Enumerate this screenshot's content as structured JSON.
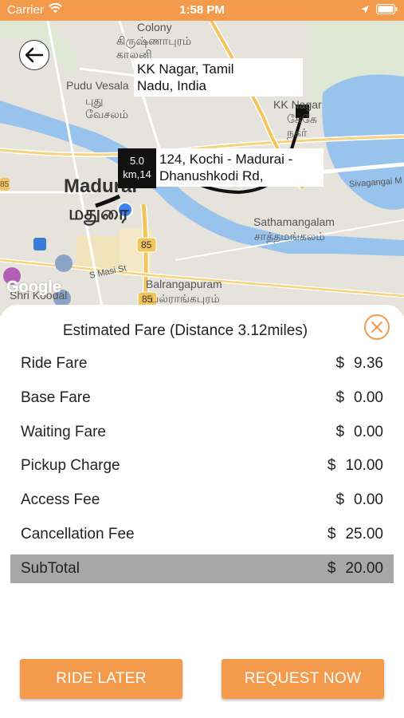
{
  "status_bar": {
    "carrier": "Carrier",
    "time": "1:58 PM",
    "icons": [
      "wifi-icon",
      "location-arrow-icon",
      "battery-icon"
    ]
  },
  "map": {
    "labels": {
      "colony": "Colony",
      "tamil_top": "கிருஷ்ணாபுரம்\nகாலனி",
      "pudu": "Pudu Vesala",
      "pudu_tamil": "புது\nவேசலம்",
      "kk_nagar": "KK Nagar",
      "kk_nagar_tamil": "கேகே\nநகர்",
      "madurai": "Madurai",
      "madurai_tamil": "மதுரை",
      "sivagangai": "Sivagangai M",
      "sathamangalam": "Sathamangalam",
      "sathamangalam_tamil": "சாத்தமங்கலம்",
      "s_masi": "S Masi St",
      "balrangapuram": "Balrangapuram",
      "balrangapuram_tamil": "பல்ராங்கபுரம்",
      "shri_koodal": "Shri Koodal",
      "road_85": "85",
      "road_85b": "85",
      "road_85_left": "85",
      "google": "Google"
    },
    "callouts": {
      "destination": "KK Nagar, Tamil\nNadu, India",
      "origin": "124, Kochi - Madurai -\nDhanushkodi Rd,"
    },
    "distance_box": "5.0\nkm,14"
  },
  "fare": {
    "title": "Estimated Fare (Distance 3.12miles)",
    "currency": "$",
    "rows": [
      {
        "label": "Ride Fare",
        "value": "9.36"
      },
      {
        "label": "Base Fare",
        "value": "0.00"
      },
      {
        "label": "Waiting Fare",
        "value": "0.00"
      },
      {
        "label": "Pickup Charge",
        "value": "10.00"
      },
      {
        "label": "Access Fee",
        "value": "0.00"
      },
      {
        "label": "Cancellation Fee",
        "value": "25.00"
      }
    ],
    "subtotal": {
      "label": "SubTotal",
      "value": "20.00"
    }
  },
  "buttons": {
    "ride_later": "RIDE LATER",
    "request_now": "REQUEST NOW"
  },
  "colors": {
    "accent": "#f39a4c",
    "subtotal_bg": "#a7a7a7",
    "route": "#111111",
    "current_location": "#3b82f6"
  }
}
